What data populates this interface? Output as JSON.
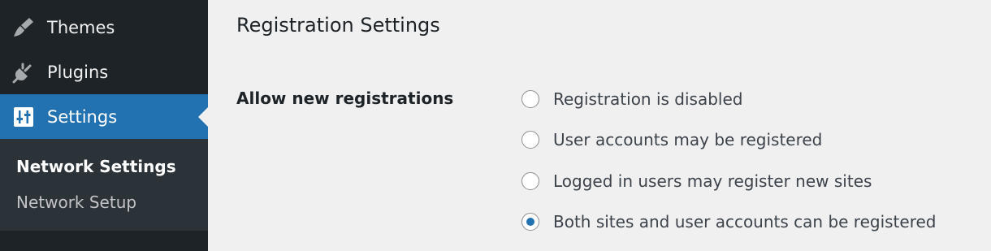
{
  "sidebar": {
    "items": [
      {
        "label": "Themes",
        "icon": "paintbrush-icon"
      },
      {
        "label": "Plugins",
        "icon": "plugin-icon"
      },
      {
        "label": "Settings",
        "icon": "settings-sliders-icon",
        "active": true
      }
    ],
    "submenu": [
      {
        "label": "Network Settings",
        "current": true
      },
      {
        "label": "Network Setup"
      }
    ]
  },
  "main": {
    "title": "Registration Settings",
    "field_label": "Allow new registrations",
    "options": [
      {
        "label": "Registration is disabled",
        "checked": false
      },
      {
        "label": "User accounts may be registered",
        "checked": false
      },
      {
        "label": "Logged in users may register new sites",
        "checked": false
      },
      {
        "label": "Both sites and user accounts can be registered",
        "checked": true
      }
    ]
  },
  "colors": {
    "sidebar_bg": "#1d2327",
    "submenu_bg": "#2c3338",
    "accent": "#2271b1",
    "page_bg": "#f0f0f1"
  }
}
